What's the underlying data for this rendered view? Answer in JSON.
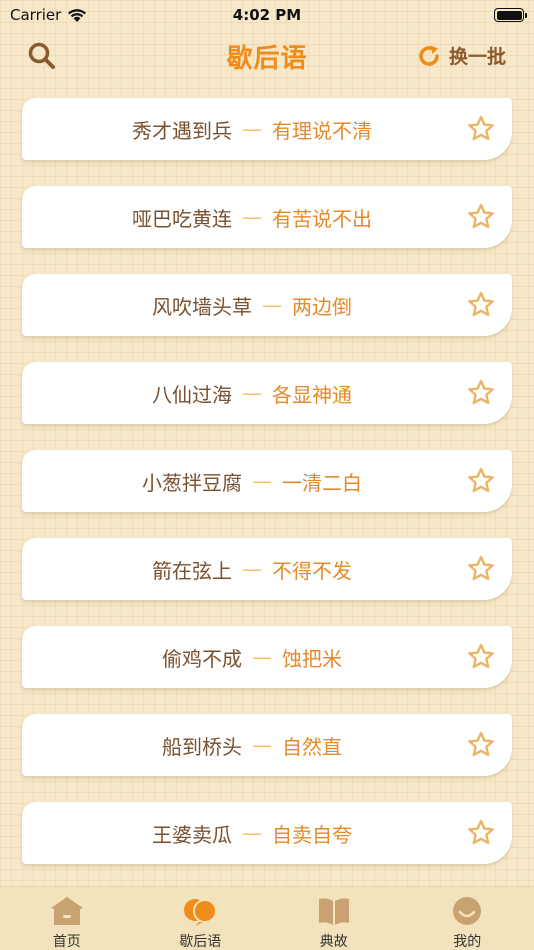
{
  "status": {
    "carrier": "Carrier",
    "time": "4:02 PM"
  },
  "nav": {
    "title": "歇后语",
    "refresh_label": "换一批"
  },
  "colors": {
    "accent": "#f08c1a",
    "brown": "#8a5a2e",
    "answer": "#e58a2b",
    "dash": "#f3c36a",
    "background": "#f6e8c9"
  },
  "items": [
    {
      "riddle": "秀才遇到兵",
      "dash": "—",
      "answer": "有理说不清"
    },
    {
      "riddle": "哑巴吃黄连",
      "dash": "—",
      "answer": "有苦说不出"
    },
    {
      "riddle": "风吹墙头草",
      "dash": "—",
      "answer": "两边倒"
    },
    {
      "riddle": "八仙过海",
      "dash": "—",
      "answer": "各显神通"
    },
    {
      "riddle": "小葱拌豆腐",
      "dash": "—",
      "answer": "一清二白"
    },
    {
      "riddle": "箭在弦上",
      "dash": "—",
      "answer": "不得不发"
    },
    {
      "riddle": "偷鸡不成",
      "dash": "—",
      "answer": "蚀把米"
    },
    {
      "riddle": "船到桥头",
      "dash": "—",
      "answer": "自然直"
    },
    {
      "riddle": "王婆卖瓜",
      "dash": "—",
      "answer": "自卖自夸"
    }
  ],
  "tabs": [
    {
      "label": "首页",
      "icon": "home-icon"
    },
    {
      "label": "歇后语",
      "icon": "chat-bubbles-icon",
      "active": true
    },
    {
      "label": "典故",
      "icon": "book-icon"
    },
    {
      "label": "我的",
      "icon": "smiley-icon"
    }
  ]
}
